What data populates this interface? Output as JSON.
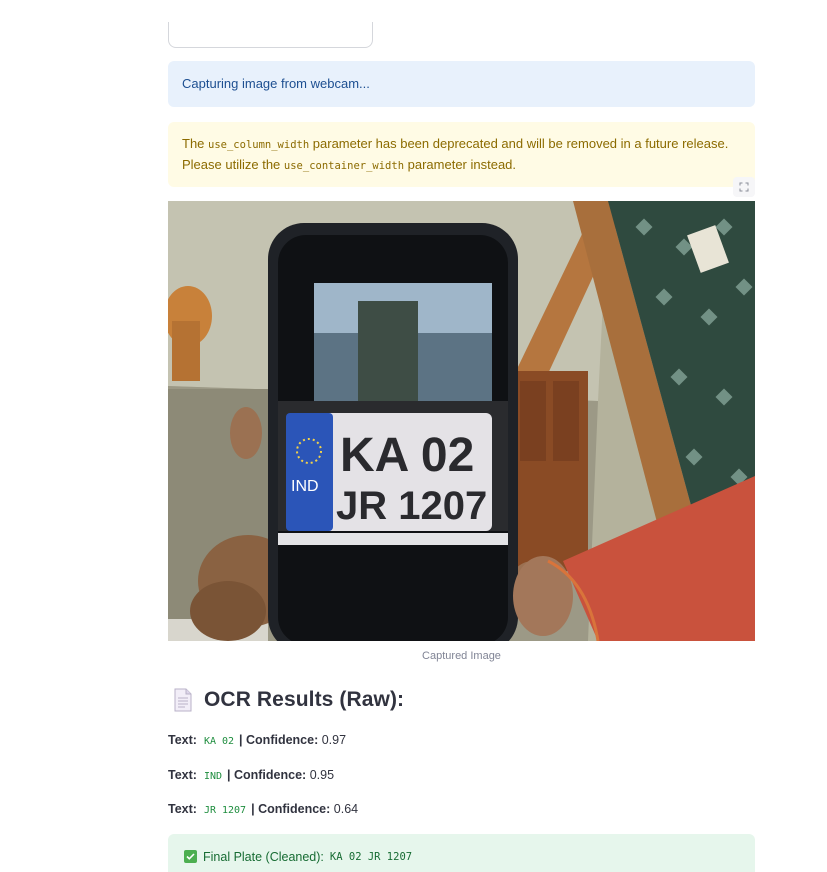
{
  "info_alert": {
    "text": "Capturing image from webcam..."
  },
  "warning_alert": {
    "part1": "The ",
    "code1": "use_column_width",
    "part2": " parameter has been deprecated and will be removed in a future release. Please utilize the ",
    "code2": "use_container_width",
    "part3": " parameter instead."
  },
  "image": {
    "caption": "Captured Image",
    "plate_line1": "KA 02",
    "plate_line2": "JR 1207",
    "plate_country": "IND"
  },
  "ocr": {
    "heading": "OCR Results (Raw):",
    "text_label": "Text:",
    "confidence_label": "| Confidence:",
    "results": [
      {
        "text": "KA 02",
        "confidence": "0.97"
      },
      {
        "text": "IND",
        "confidence": "0.95"
      },
      {
        "text": "JR 1207",
        "confidence": "0.64"
      }
    ]
  },
  "final": {
    "label": "Final Plate (Cleaned):",
    "value": "KA 02 JR 1207"
  },
  "colors": {
    "info_bg": "#e8f1fc",
    "warning_bg": "#fffbe5",
    "success_bg": "#e6f6ec",
    "success_accent": "#4caf50"
  }
}
